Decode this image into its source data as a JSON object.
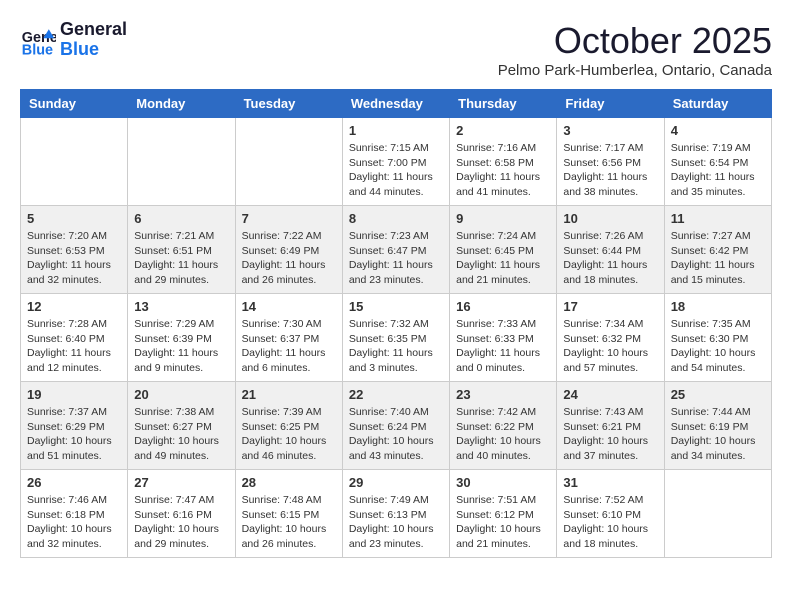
{
  "header": {
    "logo_line1": "General",
    "logo_line2": "Blue",
    "month_title": "October 2025",
    "location": "Pelmo Park-Humberlea, Ontario, Canada"
  },
  "days_of_week": [
    "Sunday",
    "Monday",
    "Tuesday",
    "Wednesday",
    "Thursday",
    "Friday",
    "Saturday"
  ],
  "weeks": [
    [
      {
        "day": "",
        "info": ""
      },
      {
        "day": "",
        "info": ""
      },
      {
        "day": "",
        "info": ""
      },
      {
        "day": "1",
        "info": "Sunrise: 7:15 AM\nSunset: 7:00 PM\nDaylight: 11 hours and 44 minutes."
      },
      {
        "day": "2",
        "info": "Sunrise: 7:16 AM\nSunset: 6:58 PM\nDaylight: 11 hours and 41 minutes."
      },
      {
        "day": "3",
        "info": "Sunrise: 7:17 AM\nSunset: 6:56 PM\nDaylight: 11 hours and 38 minutes."
      },
      {
        "day": "4",
        "info": "Sunrise: 7:19 AM\nSunset: 6:54 PM\nDaylight: 11 hours and 35 minutes."
      }
    ],
    [
      {
        "day": "5",
        "info": "Sunrise: 7:20 AM\nSunset: 6:53 PM\nDaylight: 11 hours and 32 minutes."
      },
      {
        "day": "6",
        "info": "Sunrise: 7:21 AM\nSunset: 6:51 PM\nDaylight: 11 hours and 29 minutes."
      },
      {
        "day": "7",
        "info": "Sunrise: 7:22 AM\nSunset: 6:49 PM\nDaylight: 11 hours and 26 minutes."
      },
      {
        "day": "8",
        "info": "Sunrise: 7:23 AM\nSunset: 6:47 PM\nDaylight: 11 hours and 23 minutes."
      },
      {
        "day": "9",
        "info": "Sunrise: 7:24 AM\nSunset: 6:45 PM\nDaylight: 11 hours and 21 minutes."
      },
      {
        "day": "10",
        "info": "Sunrise: 7:26 AM\nSunset: 6:44 PM\nDaylight: 11 hours and 18 minutes."
      },
      {
        "day": "11",
        "info": "Sunrise: 7:27 AM\nSunset: 6:42 PM\nDaylight: 11 hours and 15 minutes."
      }
    ],
    [
      {
        "day": "12",
        "info": "Sunrise: 7:28 AM\nSunset: 6:40 PM\nDaylight: 11 hours and 12 minutes."
      },
      {
        "day": "13",
        "info": "Sunrise: 7:29 AM\nSunset: 6:39 PM\nDaylight: 11 hours and 9 minutes."
      },
      {
        "day": "14",
        "info": "Sunrise: 7:30 AM\nSunset: 6:37 PM\nDaylight: 11 hours and 6 minutes."
      },
      {
        "day": "15",
        "info": "Sunrise: 7:32 AM\nSunset: 6:35 PM\nDaylight: 11 hours and 3 minutes."
      },
      {
        "day": "16",
        "info": "Sunrise: 7:33 AM\nSunset: 6:33 PM\nDaylight: 11 hours and 0 minutes."
      },
      {
        "day": "17",
        "info": "Sunrise: 7:34 AM\nSunset: 6:32 PM\nDaylight: 10 hours and 57 minutes."
      },
      {
        "day": "18",
        "info": "Sunrise: 7:35 AM\nSunset: 6:30 PM\nDaylight: 10 hours and 54 minutes."
      }
    ],
    [
      {
        "day": "19",
        "info": "Sunrise: 7:37 AM\nSunset: 6:29 PM\nDaylight: 10 hours and 51 minutes."
      },
      {
        "day": "20",
        "info": "Sunrise: 7:38 AM\nSunset: 6:27 PM\nDaylight: 10 hours and 49 minutes."
      },
      {
        "day": "21",
        "info": "Sunrise: 7:39 AM\nSunset: 6:25 PM\nDaylight: 10 hours and 46 minutes."
      },
      {
        "day": "22",
        "info": "Sunrise: 7:40 AM\nSunset: 6:24 PM\nDaylight: 10 hours and 43 minutes."
      },
      {
        "day": "23",
        "info": "Sunrise: 7:42 AM\nSunset: 6:22 PM\nDaylight: 10 hours and 40 minutes."
      },
      {
        "day": "24",
        "info": "Sunrise: 7:43 AM\nSunset: 6:21 PM\nDaylight: 10 hours and 37 minutes."
      },
      {
        "day": "25",
        "info": "Sunrise: 7:44 AM\nSunset: 6:19 PM\nDaylight: 10 hours and 34 minutes."
      }
    ],
    [
      {
        "day": "26",
        "info": "Sunrise: 7:46 AM\nSunset: 6:18 PM\nDaylight: 10 hours and 32 minutes."
      },
      {
        "day": "27",
        "info": "Sunrise: 7:47 AM\nSunset: 6:16 PM\nDaylight: 10 hours and 29 minutes."
      },
      {
        "day": "28",
        "info": "Sunrise: 7:48 AM\nSunset: 6:15 PM\nDaylight: 10 hours and 26 minutes."
      },
      {
        "day": "29",
        "info": "Sunrise: 7:49 AM\nSunset: 6:13 PM\nDaylight: 10 hours and 23 minutes."
      },
      {
        "day": "30",
        "info": "Sunrise: 7:51 AM\nSunset: 6:12 PM\nDaylight: 10 hours and 21 minutes."
      },
      {
        "day": "31",
        "info": "Sunrise: 7:52 AM\nSunset: 6:10 PM\nDaylight: 10 hours and 18 minutes."
      },
      {
        "day": "",
        "info": ""
      }
    ]
  ]
}
